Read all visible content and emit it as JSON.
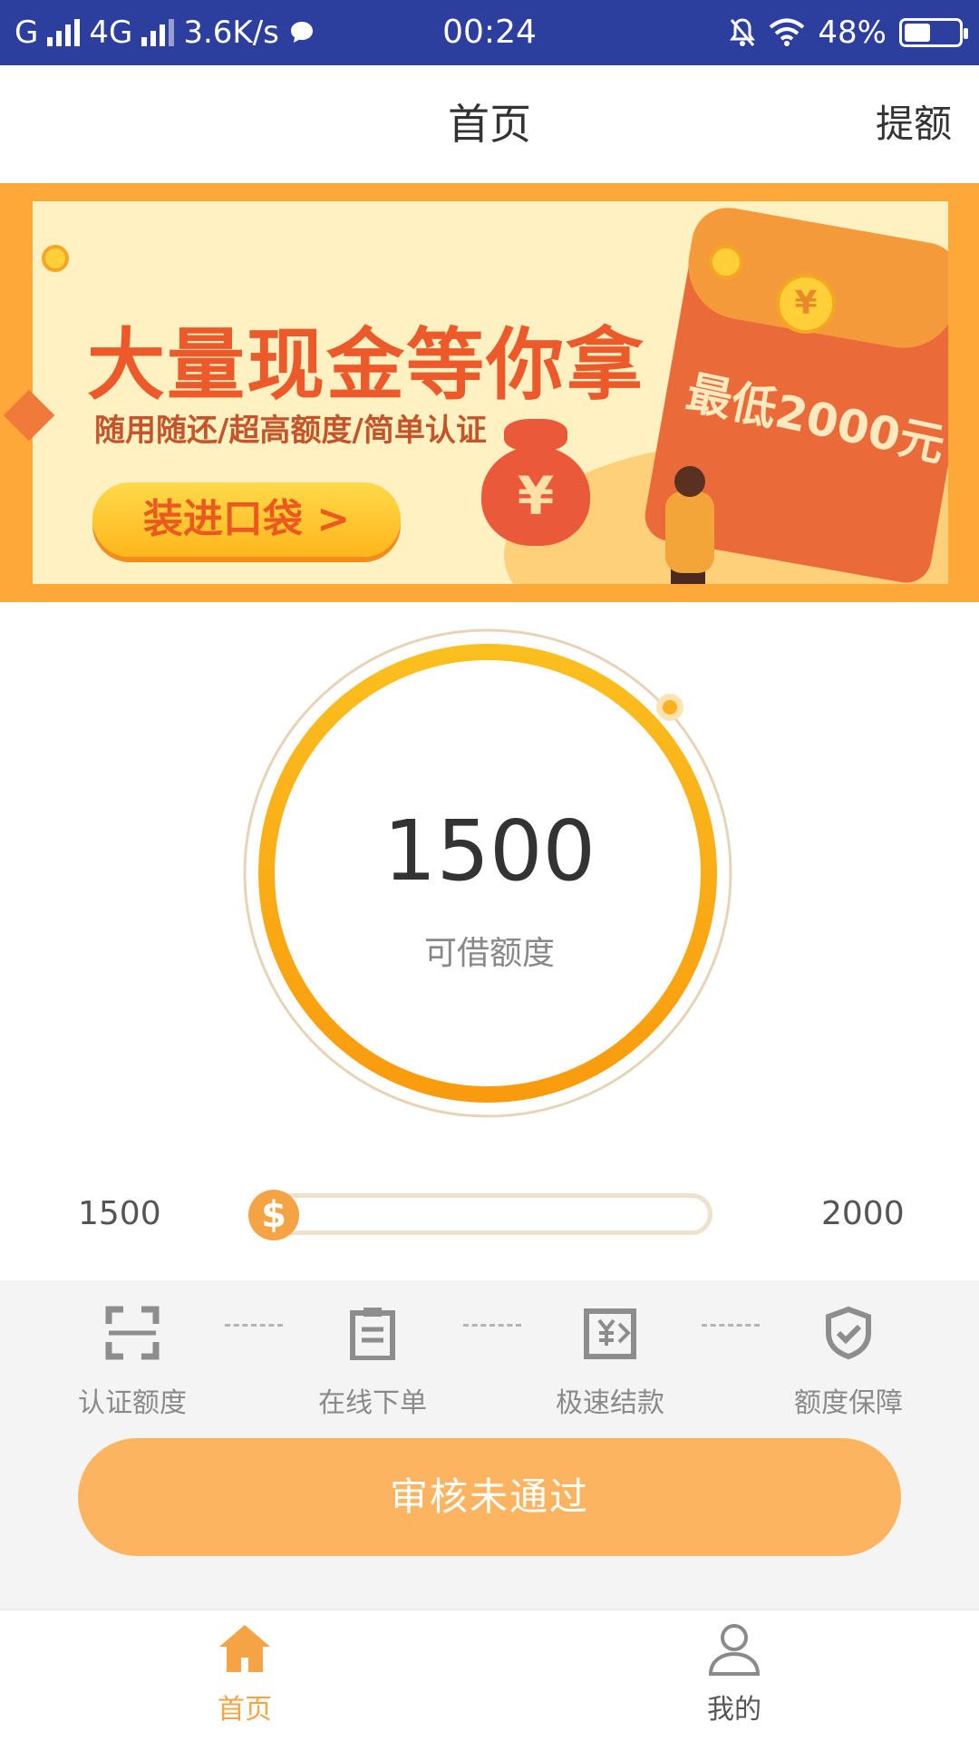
{
  "status_bar": {
    "carrier_left": "G",
    "network": "4G",
    "speed": "3.6K/s",
    "time": "00:24",
    "battery": "48%",
    "battery_level": 0.48,
    "icons": [
      "signal-icon",
      "chat-bubble-icon",
      "mute-bell-icon",
      "wifi-icon",
      "battery-icon"
    ]
  },
  "header": {
    "title": "首页",
    "right_action": "提额"
  },
  "banner": {
    "headline": "大量现金等你拿",
    "subtitle": "随用随还/超高额度/简单认证",
    "cta": "装进口袋 >",
    "envelope_text": "最低2000元",
    "coin_symbol": "¥"
  },
  "credit": {
    "amount": "1500",
    "label": "可借额度"
  },
  "slider": {
    "min": "1500",
    "max": "2000",
    "thumb_symbol": "$",
    "position": 0
  },
  "steps": [
    {
      "label": "认证额度",
      "icon": "scan-frame-icon"
    },
    {
      "label": "在线下单",
      "icon": "clipboard-icon"
    },
    {
      "label": "极速结款",
      "icon": "money-transfer-icon"
    },
    {
      "label": "额度保障",
      "icon": "shield-check-icon"
    }
  ],
  "main_button": {
    "label": "审核未通过"
  },
  "tabs": [
    {
      "label": "首页",
      "icon": "home-icon",
      "active": true
    },
    {
      "label": "我的",
      "icon": "user-icon",
      "active": false
    }
  ],
  "colors": {
    "status_bar": "#2c3f9e",
    "accent": "#fdb461",
    "ring": "#f9a620",
    "tab_active": "#f5a445",
    "tab_inactive": "#555555"
  }
}
